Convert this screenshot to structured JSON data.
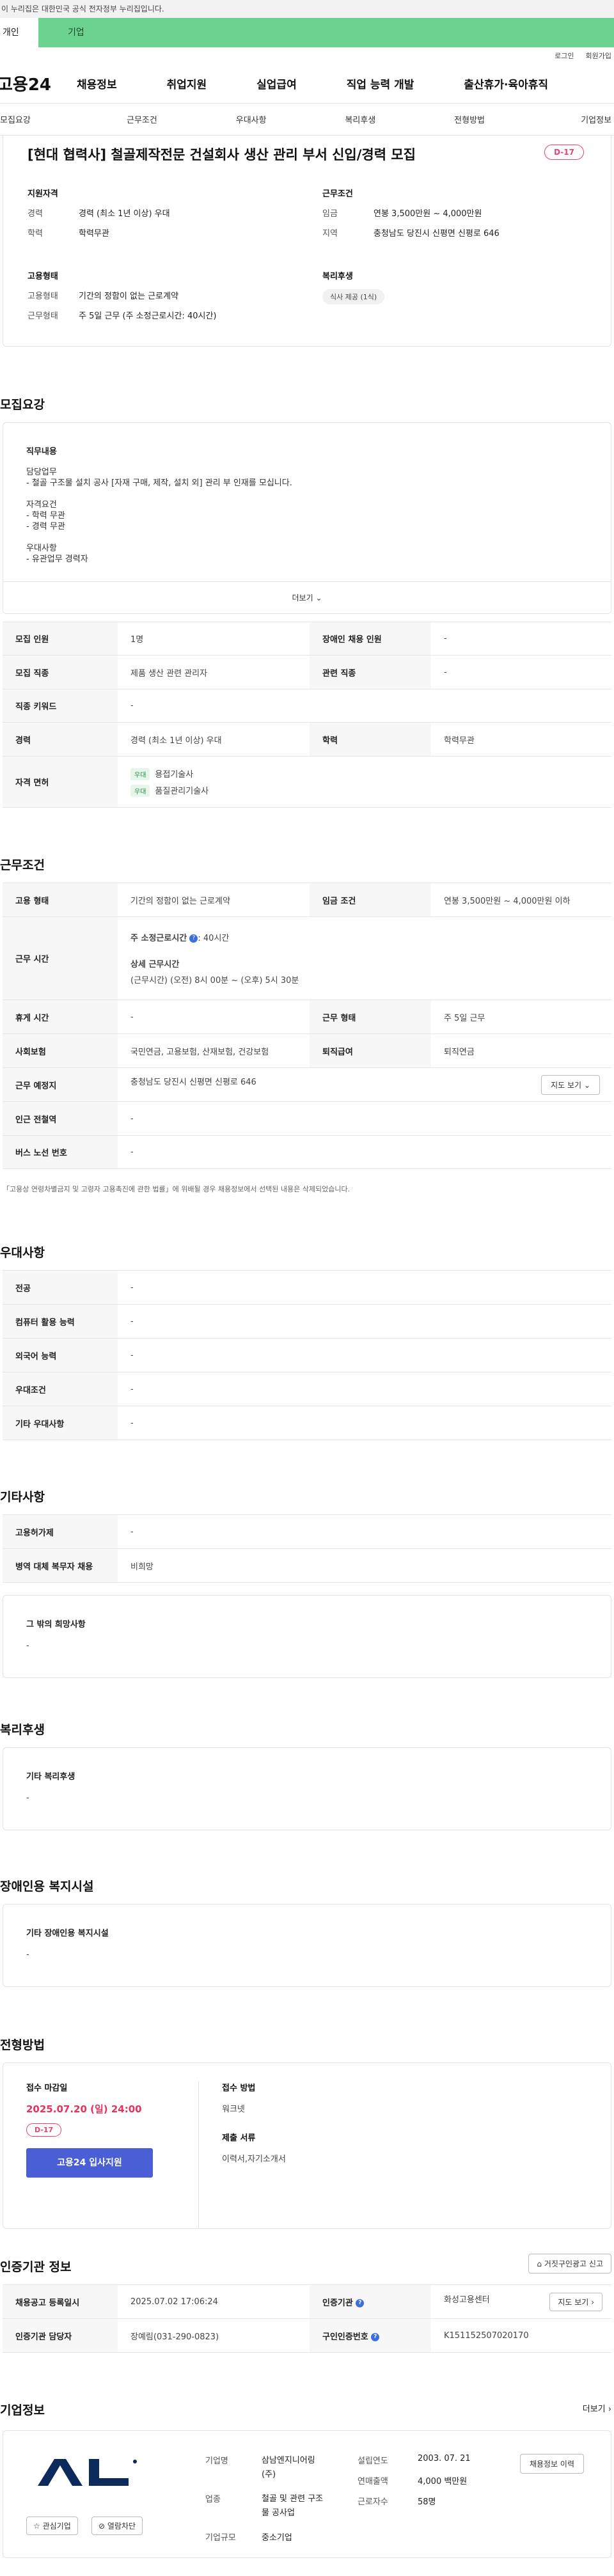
{
  "banner": {
    "text": "이 누리집은 대한민국 공식 전자정부 누리집입니다."
  },
  "user_tabs": {
    "individual": "개인",
    "company": "기업"
  },
  "util": {
    "login": "로그인",
    "signup": "회원가입"
  },
  "gnb": {
    "logo": "고용24",
    "items": [
      "채용정보",
      "취업지원",
      "실업급여",
      "직업 능력 개발",
      "출산휴가·육아휴직"
    ]
  },
  "anchor_nav": [
    "모집요강",
    "근무조건",
    "우대사항",
    "복리후생",
    "전형방법",
    "기업정보"
  ],
  "summary": {
    "title": "[현대 협력사] 철골제작전문 건설회사 생산 관리 부서 신입/경력 모집",
    "dday": "D-17",
    "qual_title": "지원자격",
    "qual": [
      {
        "k": "경력",
        "v": "경력 (최소 1년 이상) 우대"
      },
      {
        "k": "학력",
        "v": "학력무관"
      }
    ],
    "cond_title": "근무조건",
    "cond": [
      {
        "k": "임금",
        "v": "연봉 3,500만원 ~ 4,000만원"
      },
      {
        "k": "지역",
        "v": "충청남도 당진시 신평면 신평로 646"
      }
    ],
    "emp_title": "고용형태",
    "emp": [
      {
        "k": "고용형태",
        "v": "기간의 정함이 없는 근로계약"
      },
      {
        "k": "근무형태",
        "v": "주 5일 근무 (주 소정근로시간: 40시간)"
      }
    ],
    "welfare_title": "복리후생",
    "welfare_chip": "식사 제공 (1식)"
  },
  "recruit": {
    "section_title": "모집요강",
    "desc_title": "직무내용",
    "desc_lines": [
      "담당업무",
      "- 철골 구조물 설치 공사 [자재 구매, 제작, 설치 외] 관리 부 인재를 모십니다.",
      "",
      "자격요건",
      "- 학력 무관",
      "- 경력 무관",
      "",
      "우대사항",
      "- 유관업무 경력자"
    ],
    "more": "더보기",
    "rows": {
      "headcount_k": "모집 인원",
      "headcount_v": "1명",
      "disabled_k": "장애인 채용 인원",
      "disabled_v": "-",
      "job_k": "모집 직종",
      "job_v": "제품 생산 관련 관리자",
      "related_k": "관련 직종",
      "related_v": "-",
      "keyword_k": "직종 키워드",
      "keyword_v": "-",
      "career_k": "경력",
      "career_v": "경력 (최소 1년 이상) 우대",
      "edu_k": "학력",
      "edu_v": "학력무관",
      "cert_k": "자격 면허",
      "cert_tag": "우대",
      "cert1": "용접기술사",
      "cert2": "품질관리기술사"
    }
  },
  "work": {
    "section_title": "근무조건",
    "emp_type_k": "고용 형태",
    "emp_type_v": "기간의 정함이 없는 근로계약",
    "wage_k": "임금 조건",
    "wage_v": "연봉 3,500만원 ~ 4,000만원 이하",
    "hours_k": "근무 시간",
    "hours_main_label": "주 소정근로시간",
    "hours_main_val": ": 40시간",
    "hours_detail_label": "상세 근무시간",
    "hours_detail_val": "(근무시간) (오전) 8시 00분 ~ (오후) 5시 30분",
    "break_k": "휴게 시간",
    "break_v": "-",
    "shift_k": "근무 형태",
    "shift_v": "주 5일 근무",
    "insurance_k": "사회보험",
    "insurance_v": "국민연금, 고용보험, 산재보험, 건강보험",
    "severance_k": "퇴직급여",
    "severance_v": "퇴직연금",
    "location_k": "근무 예정지",
    "location_v": "충청남도 당진시 신평면 신평로 646",
    "map_btn": "지도 보기",
    "station_k": "인근 전철역",
    "station_v": "-",
    "bus_k": "버스 노선 번호",
    "bus_v": "-",
    "note": "「고용상 연령차별금지 및 고령자 고용촉진에 관한 법률」에 위배될 경우 채용정보에서 선택된 내용은 삭제되었습니다."
  },
  "preference": {
    "section_title": "우대사항",
    "rows": [
      {
        "k": "전공",
        "v": "-"
      },
      {
        "k": "컴퓨터 활용 능력",
        "v": "-"
      },
      {
        "k": "외국어 능력",
        "v": "-"
      },
      {
        "k": "우대조건",
        "v": "-"
      },
      {
        "k": "기타 우대사항",
        "v": "-"
      }
    ]
  },
  "etc": {
    "section_title": "기타사항",
    "rows": [
      {
        "k": "고용허가제",
        "v": "-"
      },
      {
        "k": "병역 대체 복무자 채용",
        "v": "비희망"
      }
    ],
    "other_title": "그 밖의 희망사항",
    "other_v": "-"
  },
  "welfare": {
    "section_title": "복리후생",
    "box_title": "기타 복리후생",
    "box_v": "-"
  },
  "disability": {
    "section_title": "장애인용 복지시설",
    "box_title": "기타 장애인용 복지시설",
    "box_v": "-"
  },
  "process": {
    "section_title": "전형방법",
    "deadline_label": "접수 마감일",
    "deadline": "2025.07.20 (일) 24:00",
    "dday": "D-17",
    "apply": "고용24 입사지원",
    "method_label": "접수 방법",
    "method_v": "워크넷",
    "docs_label": "제출 서류",
    "docs_v": "이력서,자기소개서"
  },
  "cert_org": {
    "section_title": "인증기관 정보",
    "report": "거짓구인광고 신고",
    "reg_k": "채용공고 등록일시",
    "reg_v": "2025.07.02 17:06:24",
    "org_k": "인증기관",
    "org_v": "화성고용센터",
    "map_btn": "지도 보기",
    "manager_k": "인증기관 담당자",
    "manager_v": "장예림(031-290-0823)",
    "no_k": "구인인증번호",
    "no_v": "K151152507020170"
  },
  "company": {
    "section_title": "기업정보",
    "more": "더보기",
    "fav": "관심기업",
    "block": "열람차단",
    "name_k": "기업명",
    "name_v1": "삼남엔지니어링",
    "name_v2": "(주)",
    "biz_k": "업종",
    "biz_v1": "철골 및 관련 구조",
    "biz_v2": "물 공사업",
    "size_k": "기업규모",
    "size_v": "중소기업",
    "found_k": "설립연도",
    "found_v": "2003. 07. 21",
    "sales_k": "연매출액",
    "sales_v": "4,000 백만원",
    "emp_k": "근로자수",
    "emp_v": "58명",
    "hire_btn": "채용정보 이력"
  }
}
